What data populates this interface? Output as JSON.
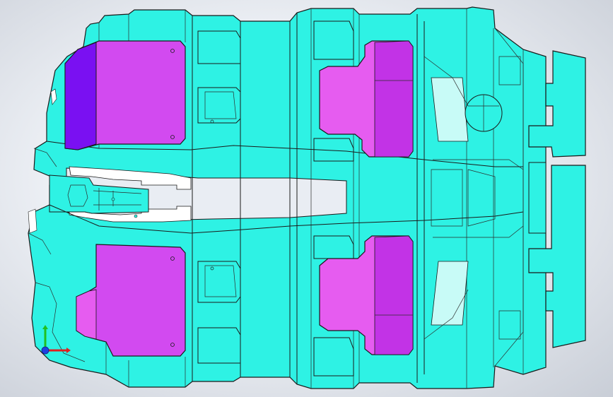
{
  "viewport": {
    "model_part": "floor-pan-assembly",
    "colors": {
      "body": "#2ef2e4",
      "body_shade": "#24d6cc",
      "body_light": "#c8fbf7",
      "pad_magenta": "#d24af0",
      "pad_violet": "#7a10f2",
      "pad_pink": "#e65cf0",
      "pad_edge": "#b230dc",
      "cutout_white": "#ffffff",
      "triad_x": "#e02020",
      "triad_y": "#20c020",
      "triad_z": "#2040e0"
    }
  },
  "triad": {
    "axes": [
      "x-axis",
      "y-axis",
      "z-axis"
    ]
  }
}
